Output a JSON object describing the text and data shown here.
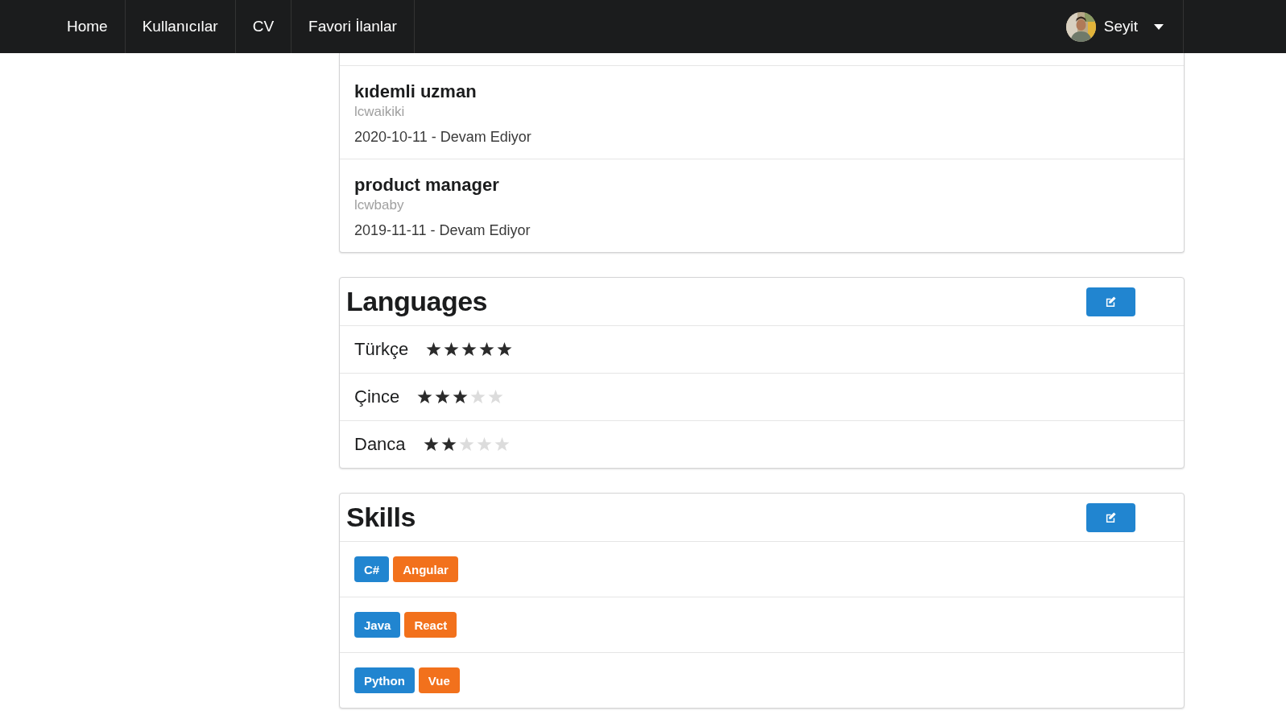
{
  "nav": {
    "items": [
      {
        "label": "Home"
      },
      {
        "label": "Kullanıcılar"
      },
      {
        "label": "CV"
      },
      {
        "label": "Favori İlanlar"
      }
    ],
    "user": {
      "name": "Seyit"
    }
  },
  "experience": {
    "items": [
      {
        "title": "kıdemli uzman",
        "company": "lcwaikiki",
        "dates": "2020-10-11 - Devam Ediyor"
      },
      {
        "title": "product manager",
        "company": "lcwbaby",
        "dates": "2019-11-11 - Devam Ediyor"
      }
    ]
  },
  "languages": {
    "title": "Languages",
    "items": [
      {
        "name": "Türkçe",
        "stars": 5
      },
      {
        "name": "Çince",
        "stars": 3
      },
      {
        "name": "Danca",
        "stars": 2
      }
    ]
  },
  "skills": {
    "title": "Skills",
    "rows": [
      {
        "tags": [
          {
            "label": "C#",
            "color": "#2185d0"
          },
          {
            "label": "Angular",
            "color": "#f2711c"
          }
        ]
      },
      {
        "tags": [
          {
            "label": "Java",
            "color": "#2185d0"
          },
          {
            "label": "React",
            "color": "#f2711c"
          }
        ]
      },
      {
        "tags": [
          {
            "label": "Python",
            "color": "#2185d0"
          },
          {
            "label": "Vue",
            "color": "#f2711c"
          }
        ]
      }
    ]
  }
}
